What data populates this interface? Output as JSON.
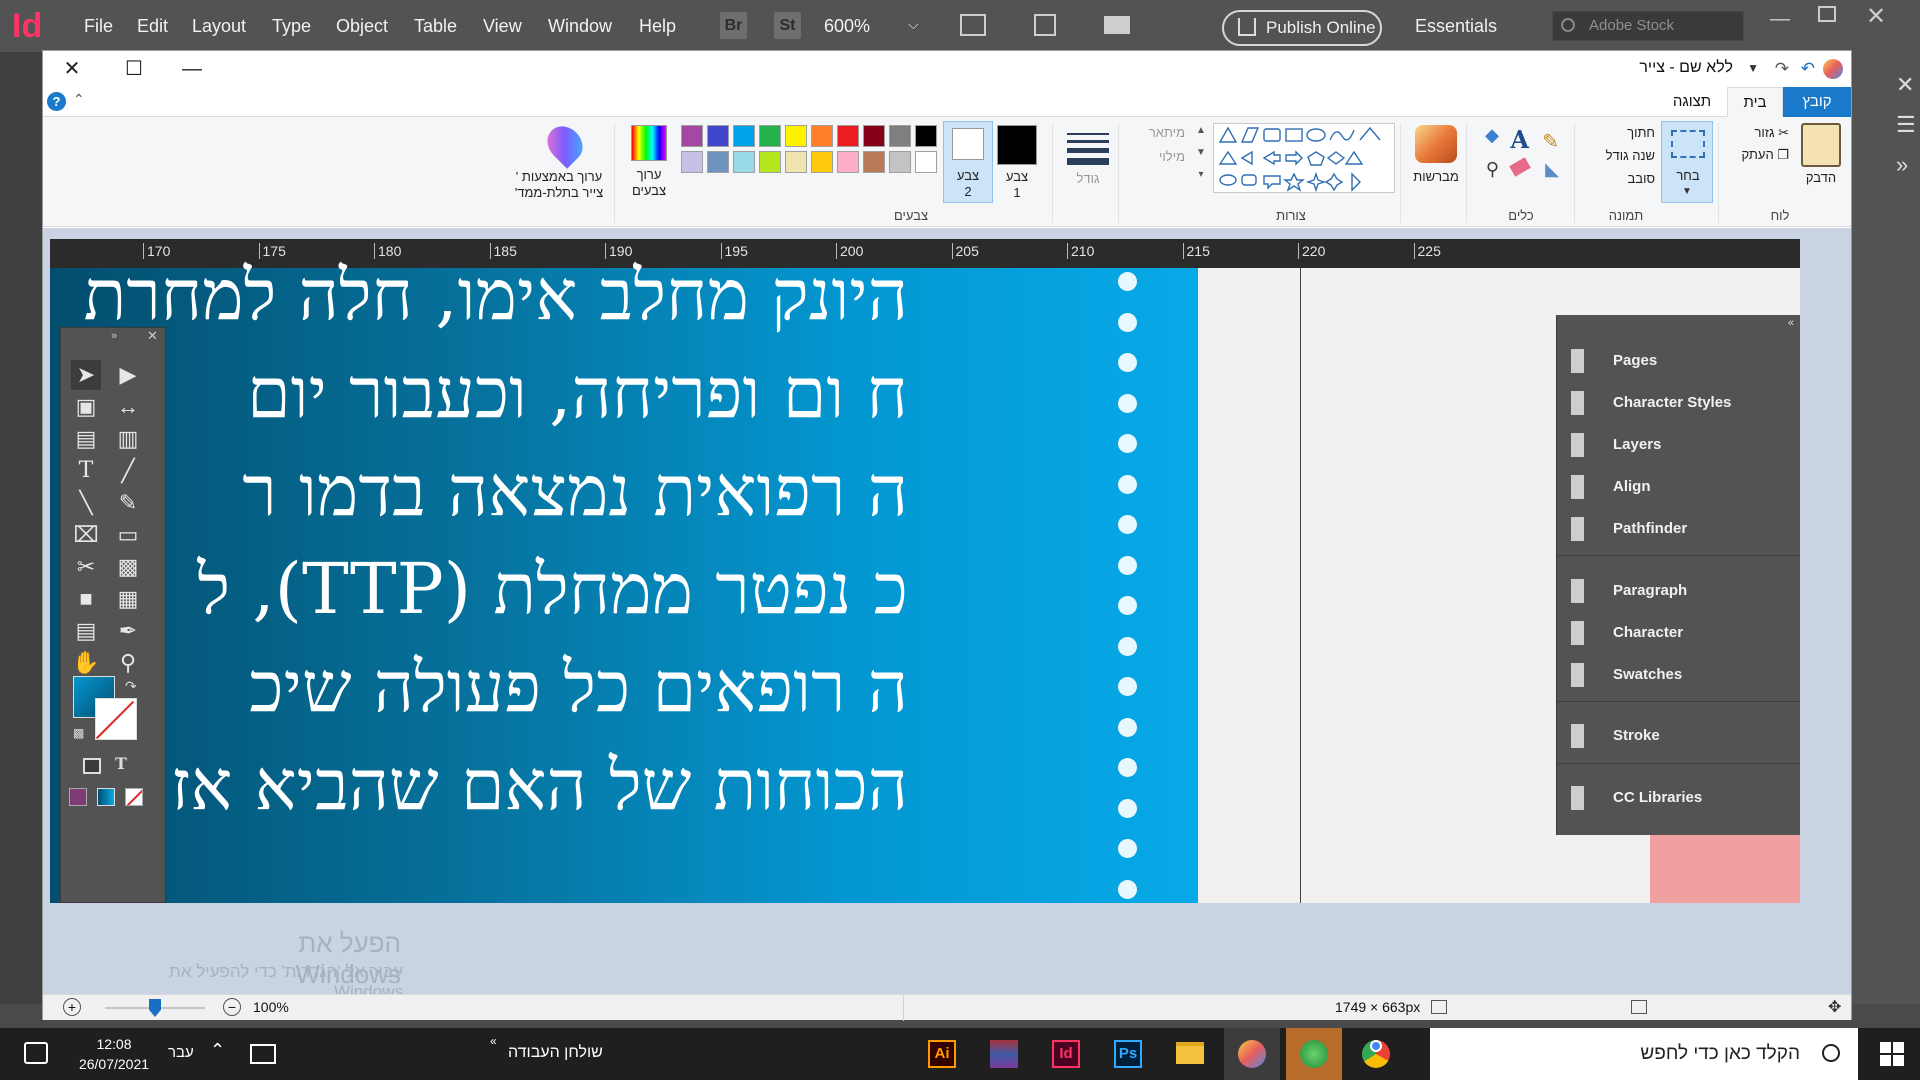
{
  "indesign": {
    "logo": "Id",
    "menu": [
      "File",
      "Edit",
      "Layout",
      "Type",
      "Object",
      "Table",
      "View",
      "Window",
      "Help"
    ],
    "bridge_badge": "Br",
    "stock_badge": "St",
    "zoom": "600%",
    "publish": "Publish Online",
    "workspace": "Essentials",
    "stock_placeholder": "Adobe Stock"
  },
  "paint": {
    "title": "ללא שם - צייר",
    "tabs": {
      "file": "קובץ",
      "home": "בית",
      "view": "תצוגה"
    },
    "groups": {
      "clipboard": "לוח",
      "image": "תמונה",
      "tools": "כלים",
      "shapes": "צורות",
      "colors": "צבעים"
    },
    "clipboard": {
      "paste": "הדבק",
      "cut": "גזור",
      "copy": "העתק"
    },
    "image": {
      "select": "בחר",
      "crop": "חתוך",
      "resize": "שנה גודל",
      "rotate": "סובב"
    },
    "brushes": "מברשות",
    "shapes": {
      "outline": "מיתאר",
      "fill": "מילוי"
    },
    "size": "גודל",
    "color1": "צבע\n1",
    "color2": "צבע\n2",
    "edit_colors": "ערוך\nצבעים",
    "edit_3d": "ערוך באמצעות ' צייר בתלת-ממד'",
    "palette_row1": [
      "#000000",
      "#7f7f7f",
      "#880015",
      "#ed1c24",
      "#ff7f27",
      "#fff200",
      "#22b14c",
      "#00a2e8",
      "#3f48cc",
      "#a349a4"
    ],
    "palette_row2": [
      "#ffffff",
      "#c3c3c3",
      "#b97a57",
      "#ffaec9",
      "#ffc90e",
      "#efe4b0",
      "#b5e61d",
      "#99d9ea",
      "#7092be",
      "#c8bfe7"
    ],
    "ruler": [
      "170",
      "175",
      "180",
      "185",
      "190",
      "195",
      "200",
      "205",
      "210",
      "215",
      "220",
      "225"
    ],
    "hebrew_lines": [
      "היונק מחלב אימו, חלה למחרת",
      "ח ום  ופריחה,  וכעבור  יום",
      "ה רפואית  נמצאה  בדמו  ר",
      "כ נפטר  ממחלת  (TTP), ל",
      "ה רופאים  כל  פעולה  שיכ",
      "הכוחות של האם שהביא אז"
    ],
    "panel_items": [
      {
        "label": "Pages",
        "icon": "pages-icon"
      },
      {
        "label": "Character Styles",
        "icon": "character-styles-icon"
      },
      {
        "label": "Layers",
        "icon": "layers-icon"
      },
      {
        "label": "Align",
        "icon": "align-icon"
      },
      {
        "label": "Pathfinder",
        "icon": "pathfinder-icon"
      },
      {
        "label": "Paragraph",
        "icon": "paragraph-icon"
      },
      {
        "label": "Character",
        "icon": "character-icon"
      },
      {
        "label": "Swatches",
        "icon": "swatches-icon"
      },
      {
        "label": "Stroke",
        "icon": "stroke-icon"
      },
      {
        "label": "CC Libraries",
        "icon": "cc-libraries-icon"
      }
    ],
    "watermark_title": "הפעל את Windows",
    "watermark_sub": "עבור אל 'הגדרות' כדי להפעיל את Windows.",
    "status_dimensions": "1749 × 663px",
    "zoom": "100%",
    "zoom_level": 0.5
  },
  "taskbar": {
    "search_placeholder": "הקלד כאן כדי לחפש",
    "desktop": "שולחן העבודה",
    "lang": "עבר",
    "time": "12:08",
    "date": "26/07/2021"
  }
}
